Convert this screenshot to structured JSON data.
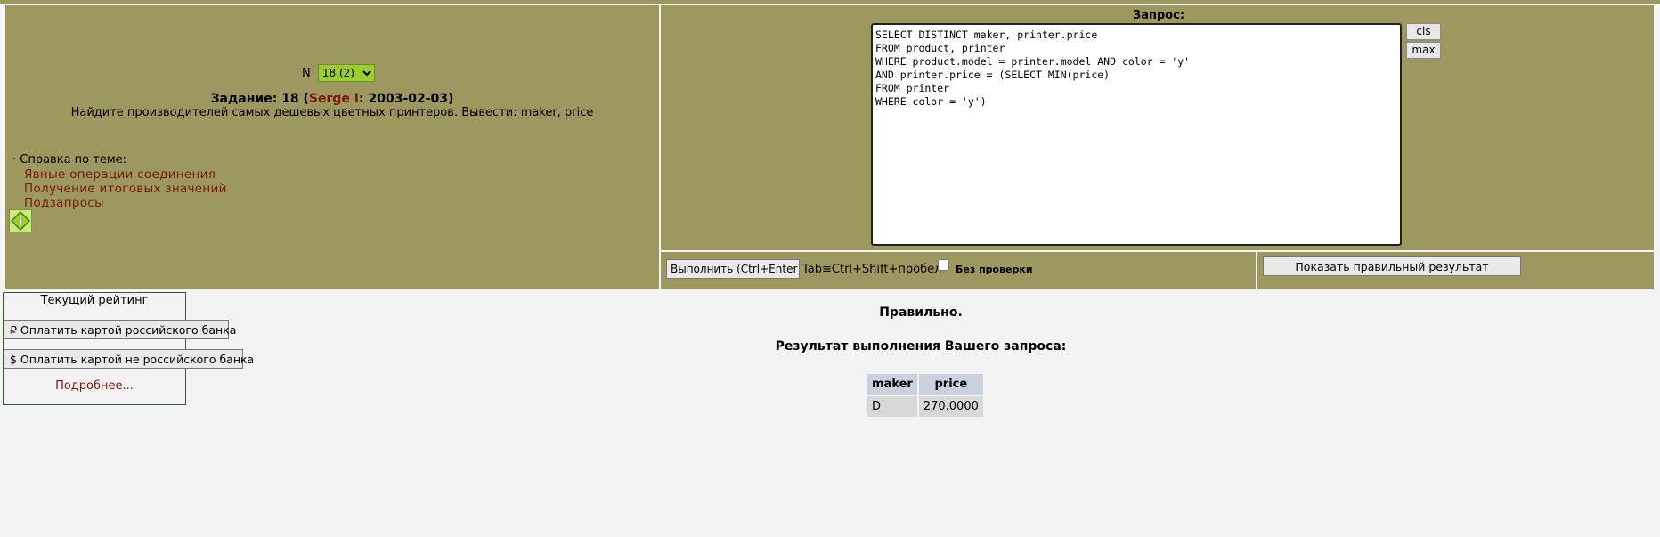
{
  "task": {
    "n_label": "N",
    "selected_option": "18 (2)",
    "title_prefix": "Задание: 18 (",
    "author": "Serge I",
    "title_suffix": ": 2003-02-03)",
    "description": "Найдите производителей самых дешевых цветных принтеров. Вывести: maker, price"
  },
  "help": {
    "heading": "· Справка по теме:",
    "links": [
      "Явные операции соединения",
      "Получение итоговых значений",
      "Подзапросы"
    ],
    "icon": "info-diamond-icon"
  },
  "query": {
    "label": "Запрос:",
    "text": "SELECT DISTINCT maker, printer.price\nFROM product, printer\nWHERE product.model = printer.model AND color = 'y'\nAND printer.price = (SELECT MIN(price)\nFROM printer\nWHERE color = 'y')",
    "cls_label": "cls",
    "max_label": "max"
  },
  "execution": {
    "execute_label": "Выполнить (Ctrl+Enter)",
    "tab_hint": "Tab≡Ctrl+Shift+пробел",
    "no_check_label": "Без  проверки",
    "show_result_label": "Показать правильный результат"
  },
  "rating": {
    "title": "Текущий рейтинг",
    "pay_ru": "₽ Оплатить картой российского банка",
    "pay_foreign": "$ Оплатить картой не российского банка",
    "more": "Подробнее..."
  },
  "result": {
    "status": "Правильно.",
    "heading": "Результат выполнения Вашего запроса:",
    "columns": [
      "maker",
      "price"
    ],
    "rows": [
      [
        "D",
        "270.0000"
      ]
    ]
  },
  "colors": {
    "panel": "#9d985f",
    "link": "#7a1a0d",
    "select_bg": "#9acd32",
    "background": "#f3f3f3"
  }
}
